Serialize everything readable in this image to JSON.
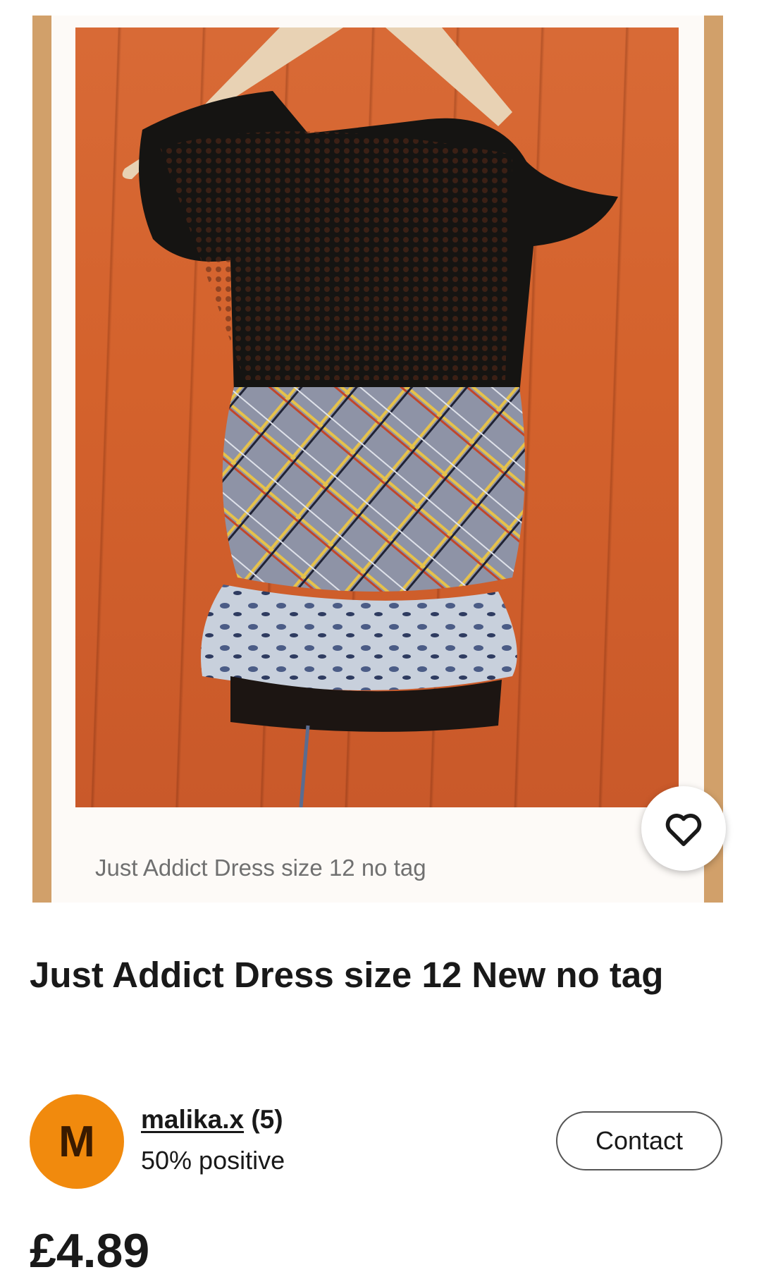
{
  "gallery": {
    "image_caption": "Just Addict Dress size 12 no tag",
    "favorite_icon": "heart-outline-icon"
  },
  "listing": {
    "title": "Just Addict Dress size 12 New no tag",
    "price": "£4.89"
  },
  "seller": {
    "avatar_initial": "M",
    "avatar_color": "#f18a0d",
    "name": "malika.x",
    "feedback_count": "(5)",
    "feedback_percent": "50% positive",
    "contact_label": "Contact"
  }
}
